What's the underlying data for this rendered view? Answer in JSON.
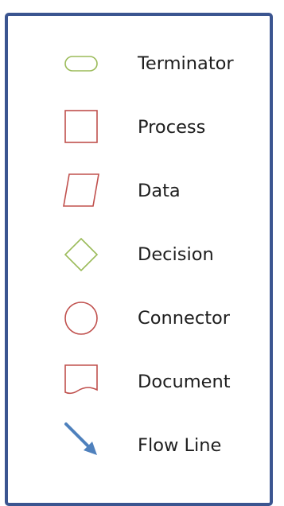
{
  "legend": {
    "items": [
      {
        "label": "Terminator",
        "icon": "terminator-shape",
        "color": "#9bbb59"
      },
      {
        "label": "Process",
        "icon": "process-shape",
        "color": "#c0504d"
      },
      {
        "label": "Data",
        "icon": "data-shape",
        "color": "#c0504d"
      },
      {
        "label": "Decision",
        "icon": "decision-shape",
        "color": "#9bbb59"
      },
      {
        "label": "Connector",
        "icon": "connector-shape",
        "color": "#c0504d"
      },
      {
        "label": "Document",
        "icon": "document-shape",
        "color": "#c0504d"
      },
      {
        "label": "Flow Line",
        "icon": "flow-line-arrow",
        "color": "#4f81bd"
      }
    ]
  }
}
